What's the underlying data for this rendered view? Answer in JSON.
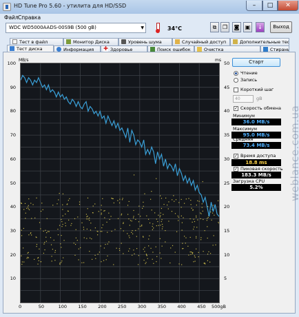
{
  "window": {
    "title": "HD Tune Pro 5.60 - утилита для HD/SSD",
    "minimize": "–",
    "maximize": "□",
    "close": "✕"
  },
  "menu": {
    "file": "Файл",
    "help": "Справка"
  },
  "toolbar": {
    "drive": "WDC WD5000AADS-00S9B (500 gB)",
    "temperature": "34°C",
    "exit": "Выход",
    "icons": [
      "copy-icon",
      "copy-all-icon",
      "screenshot-icon",
      "save-icon",
      "download-icon"
    ]
  },
  "tabs_row1": [
    {
      "label": "Тест в файл",
      "icon": "file-icon"
    },
    {
      "label": "Монитор Диска",
      "icon": "monitor-icon"
    },
    {
      "label": "Уровень шума",
      "icon": "speaker-icon"
    },
    {
      "label": "Случайный доступ",
      "icon": "random-icon"
    },
    {
      "label": "Дополнительные тесты",
      "icon": "tests-icon"
    }
  ],
  "tabs_row2": [
    {
      "label": "Тест диска",
      "icon": "benchmark-icon",
      "active": true
    },
    {
      "label": "Информация",
      "icon": "info-icon"
    },
    {
      "label": "Здоровье",
      "icon": "health-icon"
    },
    {
      "label": "Поиск ошибок",
      "icon": "search-icon"
    },
    {
      "label": "Очистка",
      "icon": "folder-icon"
    },
    {
      "label": "Стирание",
      "icon": "erase-icon"
    }
  ],
  "chart": {
    "left_unit": "MB/s",
    "right_unit": "ms",
    "y_left_ticks": [
      "100",
      "90",
      "80",
      "70",
      "60",
      "50",
      "40",
      "30",
      "20",
      "10"
    ],
    "y_right_ticks": [
      "50",
      "45",
      "40",
      "35",
      "30",
      "25",
      "20",
      "15",
      "10",
      "5"
    ],
    "x_ticks": [
      "0",
      "50",
      "100",
      "150",
      "200",
      "250",
      "300",
      "350",
      "400",
      "450",
      "500gB"
    ]
  },
  "chart_data": {
    "type": "line",
    "xlabel": "",
    "ylabel": "",
    "xlim": [
      0,
      500
    ],
    "ylim_left": [
      0,
      100
    ],
    "ylim_right": [
      0,
      50
    ],
    "grid": true,
    "series": [
      {
        "color": "#3aa0d8",
        "axis": "left",
        "x": [
          0,
          5,
          10,
          15,
          20,
          25,
          30,
          35,
          40,
          45,
          50,
          55,
          60,
          65,
          70,
          75,
          80,
          85,
          90,
          95,
          100,
          105,
          110,
          115,
          120,
          125,
          130,
          135,
          140,
          145,
          150,
          155,
          160,
          165,
          170,
          175,
          180,
          185,
          190,
          195,
          200,
          205,
          210,
          215,
          220,
          225,
          230,
          235,
          240,
          245,
          250,
          255,
          260,
          265,
          270,
          275,
          280,
          285,
          290,
          295,
          300,
          305,
          310,
          315,
          320,
          325,
          330,
          335,
          340,
          345,
          350,
          355,
          360,
          365,
          370,
          375,
          380,
          385,
          390,
          395,
          400,
          405,
          410,
          415,
          420,
          425,
          430,
          435,
          440,
          445,
          450,
          455,
          460,
          465,
          470,
          475,
          480,
          485,
          490,
          495,
          500
        ],
        "values": [
          93,
          95,
          94,
          92,
          94,
          93,
          91,
          93,
          92,
          94,
          92,
          90,
          91,
          89,
          91,
          88,
          89,
          88,
          86,
          88,
          86,
          87,
          85,
          86,
          84,
          83,
          85,
          84,
          82,
          84,
          82,
          81,
          83,
          84,
          80,
          82,
          81,
          79,
          80,
          78,
          80,
          77,
          78,
          75,
          78,
          76,
          74,
          76,
          73,
          75,
          72,
          73,
          71,
          69,
          73,
          67,
          72,
          70,
          66,
          68,
          67,
          65,
          68,
          62,
          64,
          62,
          65,
          63,
          58,
          63,
          60,
          62,
          57,
          60,
          56,
          58,
          57,
          55,
          58,
          53,
          56,
          54,
          51,
          53,
          50,
          52,
          49,
          51,
          47,
          49,
          46,
          45,
          42,
          44,
          40,
          36,
          42,
          38,
          41,
          37,
          36
        ]
      },
      {
        "color": "#c8b84a",
        "axis": "right",
        "style": "scatter",
        "note_values": "access time points concentrated between 8 and 23 ms"
      }
    ]
  },
  "panel": {
    "start": "Старт",
    "read": "Чтение",
    "write": "Запись",
    "short_step": "Короткий шаг",
    "step_value": "40",
    "step_unit": "gB",
    "transfer_rate": "Скорость обмена",
    "minimum_label": "Минимум",
    "minimum": "36.0 MB/s",
    "maximum_label": "Максимум",
    "maximum": "95.0 MB/s",
    "average_label": "Средняя",
    "average": "73.4 MB/s",
    "access_time_label": "Время доступа",
    "access_time": "18.8 ms",
    "burst_label": "Пиковая скорость",
    "burst": "183.3 MB/s",
    "cpu_label": "Загрузка CPU",
    "cpu": "5.2%"
  },
  "watermark": "weblance.com.ua"
}
